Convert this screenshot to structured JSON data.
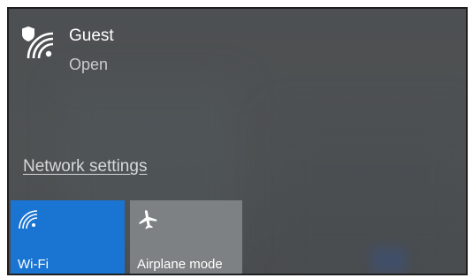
{
  "network": {
    "name": "Guest",
    "status": "Open",
    "icon": "wifi-secured-icon"
  },
  "network_settings_link": "Network settings",
  "quick_actions": {
    "wifi": {
      "label": "Wi-Fi",
      "icon": "wifi-icon",
      "state": "on",
      "color": "#1a74d2"
    },
    "airplane": {
      "label": "Airplane mode",
      "icon": "airplane-icon",
      "state": "off",
      "color": "#7e8183"
    }
  }
}
